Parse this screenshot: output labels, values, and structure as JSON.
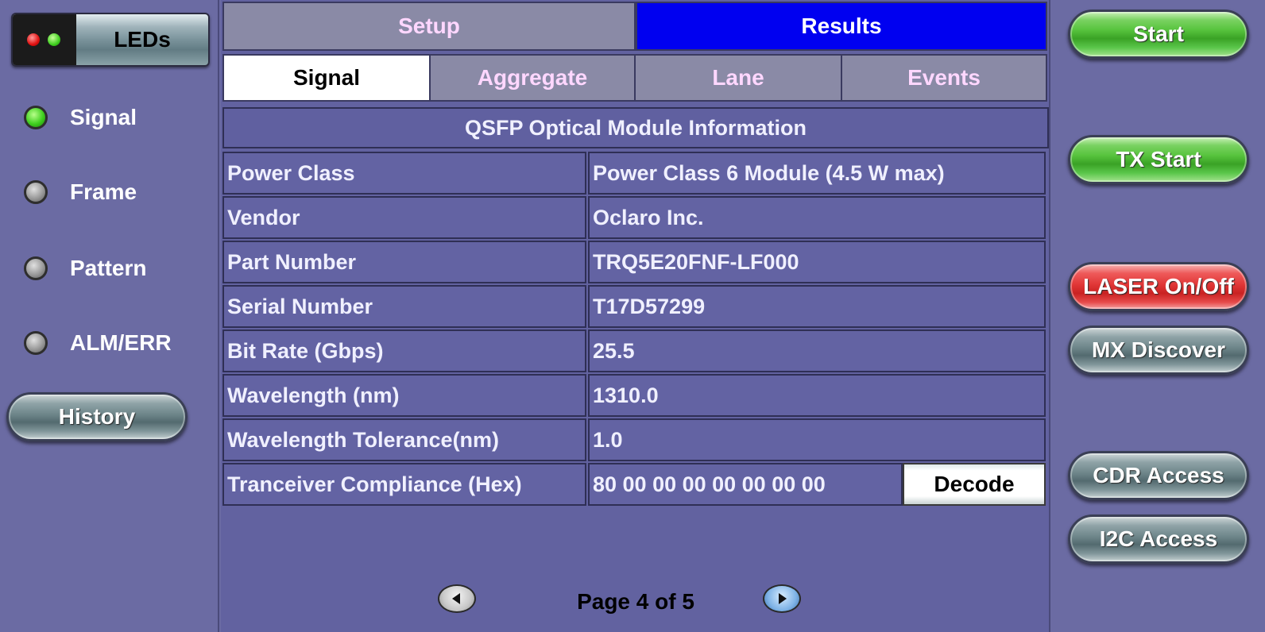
{
  "leds_panel": {
    "title": "LEDs",
    "indicators": [
      {
        "label": "Signal",
        "state": "on"
      },
      {
        "label": "Frame",
        "state": "off"
      },
      {
        "label": "Pattern",
        "state": "off"
      },
      {
        "label": "ALM/ERR",
        "state": "off"
      }
    ],
    "history_label": "History"
  },
  "top_tabs": [
    {
      "label": "Setup",
      "active": false
    },
    {
      "label": "Results",
      "active": true
    }
  ],
  "sub_tabs": [
    {
      "label": "Signal",
      "active": true
    },
    {
      "label": "Aggregate",
      "active": false
    },
    {
      "label": "Lane",
      "active": false
    },
    {
      "label": "Events",
      "active": false
    }
  ],
  "module_info": {
    "title": "QSFP Optical Module Information",
    "rows": [
      {
        "label": "Power Class",
        "value": "Power Class 6 Module (4.5 W max)"
      },
      {
        "label": "Vendor",
        "value": "Oclaro Inc."
      },
      {
        "label": "Part Number",
        "value": "TRQ5E20FNF-LF000"
      },
      {
        "label": "Serial Number",
        "value": "T17D57299"
      },
      {
        "label": "Bit Rate (Gbps)",
        "value": "25.5"
      },
      {
        "label": "Wavelength (nm)",
        "value": "1310.0"
      },
      {
        "label": "Wavelength Tolerance(nm)",
        "value": "1.0"
      },
      {
        "label": "Tranceiver Compliance (Hex)",
        "value": "80 00 00 00 00 00 00 00"
      }
    ],
    "decode_label": "Decode"
  },
  "pagination": {
    "label": "Page 4 of 5",
    "current": 4,
    "total": 5
  },
  "actions": {
    "start": "Start",
    "tx_start": "TX Start",
    "laser": "LASER On/Off",
    "mx_discover": "MX Discover",
    "cdr_access": "CDR Access",
    "i2c_access": "I2C Access"
  },
  "colors": {
    "background": "#6b6ba3",
    "active_tab": "#0000f0",
    "inactive_tab": "#8a8aa6",
    "led_on": "#3fcf1f",
    "led_off": "#9a9a9a",
    "laser_button": "#e13737",
    "start_button": "#58c43e"
  }
}
